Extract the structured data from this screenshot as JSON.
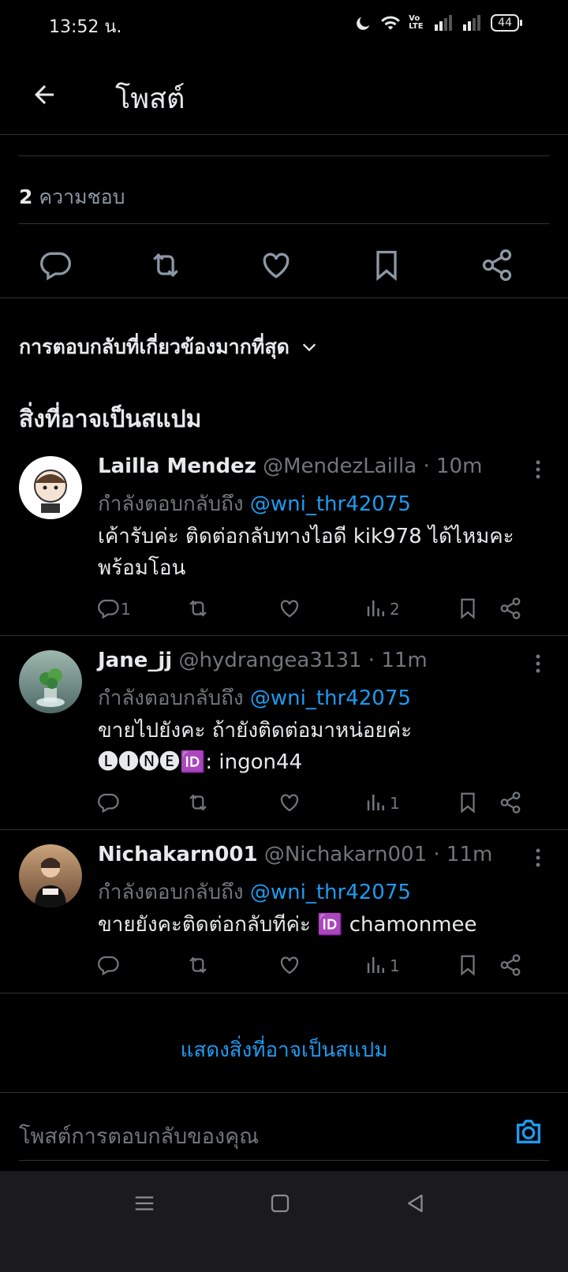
{
  "status_bar": {
    "time": "13:52 น.",
    "battery": "44",
    "volte": "Vo LTE"
  },
  "header": {
    "title": "โพสต์"
  },
  "post_stats": {
    "like_count": "2",
    "like_label": "ความชอบ"
  },
  "replies": {
    "sort_label": "การตอบกลับที่เกี่ยวข้องมากที่สุด",
    "spam_section_title": "สิ่งที่อาจเป็นสแปม",
    "replying_prefix": "กำลังตอบกลับถึง",
    "items": [
      {
        "name": "Lailla Mendez",
        "handle": "@MendezLailla",
        "time": "· 10m",
        "mention": "@wni_thr42075",
        "text": "เค้ารับค่ะ ติดต่อกลับทางไอดี kik978 ได้ไหมคะ พร้อมโอน",
        "reply_count": "1",
        "views": "2"
      },
      {
        "name": "Jane_jj",
        "handle": "@hydrangea3131",
        "time": "· 11m",
        "mention": "@wni_thr42075",
        "text_line1": "ขายไปยังคะ ถ้ายังติดต่อมาหน่อยค่ะ",
        "text_line2_badges": "🅛🅘🅝🅔🆔",
        "text_line2": ": ingon44",
        "reply_count": "",
        "views": "1"
      },
      {
        "name": "Nichakarn001",
        "handle": "@Nichakarn001",
        "time": "· 11m",
        "mention": "@wni_thr42075",
        "text": "ขายยังคะติดต่อกลับทีค่ะ",
        "id_badge": "🆔",
        "id_text": "chamonmee",
        "reply_count": "",
        "views": "1"
      }
    ],
    "show_spam_label": "แสดงสิ่งที่อาจเป็นสแปม"
  },
  "composer": {
    "placeholder": "โพสต์การตอบกลับของคุณ"
  },
  "colors": {
    "accent": "#1d9bf0",
    "muted": "#71767b",
    "background": "#000000"
  }
}
